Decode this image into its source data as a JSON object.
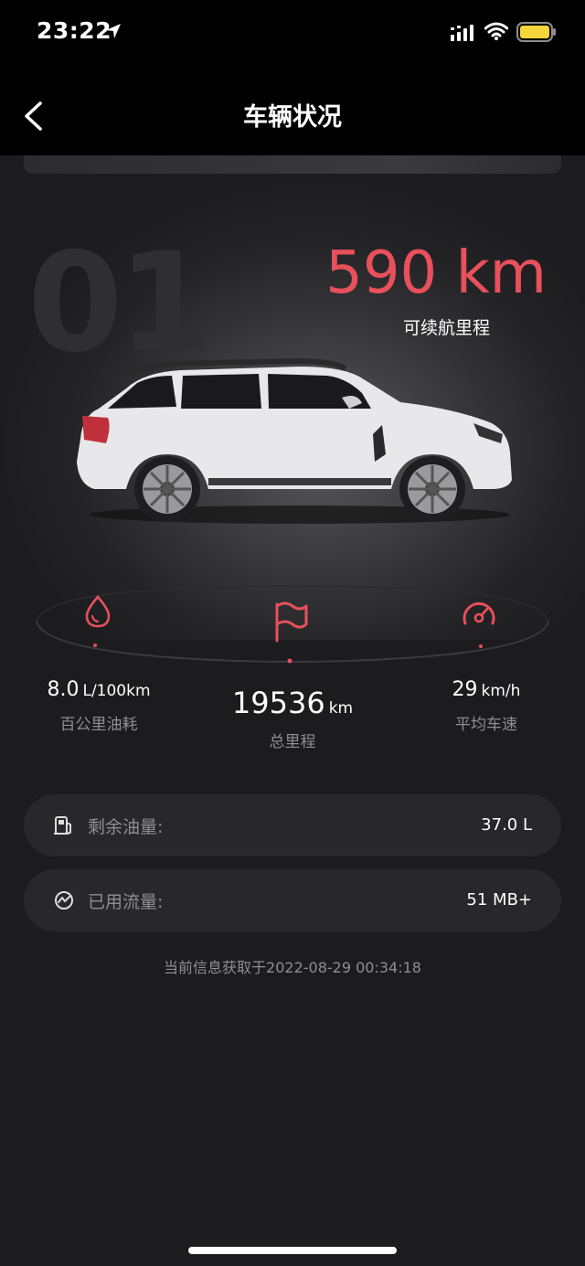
{
  "status_bar": {
    "time": "23:22",
    "icons": [
      "location-arrow-icon",
      "cellular-signal-icon",
      "wifi-icon",
      "battery-icon"
    ],
    "battery_color": "#f5d53a"
  },
  "nav": {
    "title": "车辆状况",
    "back_icon": "chevron-left-icon"
  },
  "hero": {
    "logo_text": "01",
    "range_value": "590 km",
    "range_label": "可续航里程",
    "range_color": "#e8505b"
  },
  "stats": [
    {
      "id": "fuel-consumption",
      "icon": "drop-icon",
      "value": "8.0",
      "unit": "L/100km",
      "label": "百公里油耗"
    },
    {
      "id": "total-mileage",
      "icon": "flag-icon",
      "value": "19536",
      "unit": "km",
      "label": "总里程"
    },
    {
      "id": "average-speed",
      "icon": "speedometer-icon",
      "value": "29",
      "unit": "km/h",
      "label": "平均车速"
    }
  ],
  "info_rows": [
    {
      "id": "fuel-remaining",
      "icon": "fuel-pump-icon",
      "label": "剩余油量:",
      "value": "37.0 L"
    },
    {
      "id": "data-used",
      "icon": "data-usage-icon",
      "label": "已用流量:",
      "value": "51 MB+"
    }
  ],
  "footer": {
    "timestamp": "当前信息获取于2022-08-29 00:34:18"
  },
  "accent_color": "#e8505b"
}
